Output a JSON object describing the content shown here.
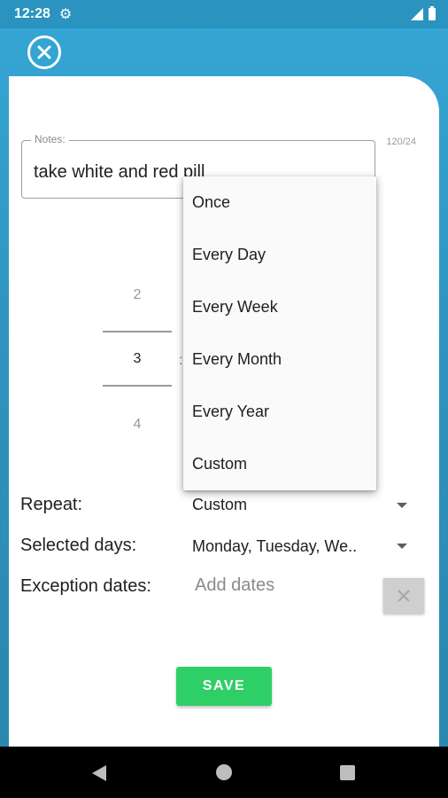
{
  "status": {
    "time": "12:28",
    "gear_icon": "gear-icon",
    "signal_icon": "signal-icon",
    "battery_icon": "battery-icon"
  },
  "notes": {
    "label": "Notes:",
    "value": "take white and red pill",
    "counter": "120/24"
  },
  "picker": {
    "prev": "2",
    "current": "3",
    "next": "4",
    "separator": ":"
  },
  "form": {
    "repeat_label": "Repeat:",
    "repeat_value": "Custom",
    "days_label": "Selected days:",
    "days_value": "Monday, Tuesday, We..",
    "exception_label": "Exception dates:",
    "exception_placeholder": "Add dates"
  },
  "save_label": "SAVE",
  "dropdown_options": [
    "Once",
    "Every Day",
    "Every Week",
    "Every Month",
    "Every Year",
    "Custom"
  ],
  "colors": {
    "accent": "#2fcf68",
    "background": "#2f93bd"
  }
}
